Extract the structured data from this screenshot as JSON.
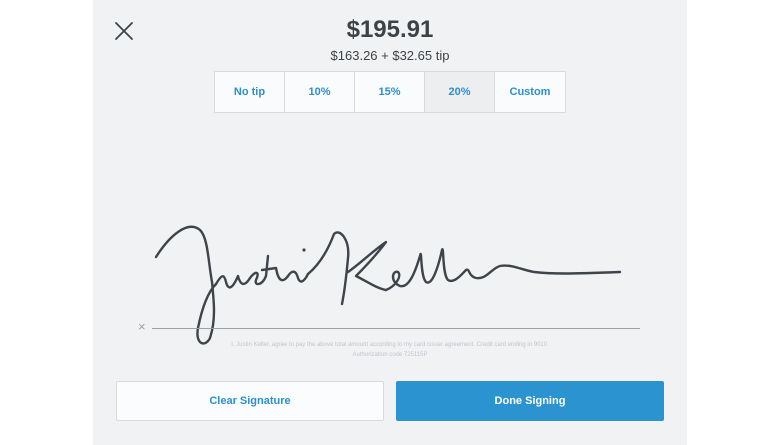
{
  "header": {
    "total": "$195.91",
    "breakdown": "$163.26 + $32.65 tip"
  },
  "tip_options": [
    {
      "label": "No tip",
      "selected": false
    },
    {
      "label": "10%",
      "selected": false
    },
    {
      "label": "15%",
      "selected": false
    },
    {
      "label": "20%",
      "selected": true
    },
    {
      "label": "Custom",
      "selected": false
    }
  ],
  "signature": {
    "marker": "×",
    "agreement": "I, Justin Keller, agree to pay the above total amount according to my card issuer agreement. Credit card ending in 9010. Authorization code 725115P"
  },
  "actions": {
    "clear_label": "Clear Signature",
    "done_label": "Done Signing"
  },
  "icons": {
    "close": "close-icon"
  },
  "colors": {
    "accent": "#2c93d1",
    "panel_bg": "#f1f2f4",
    "text": "#3d4246"
  }
}
